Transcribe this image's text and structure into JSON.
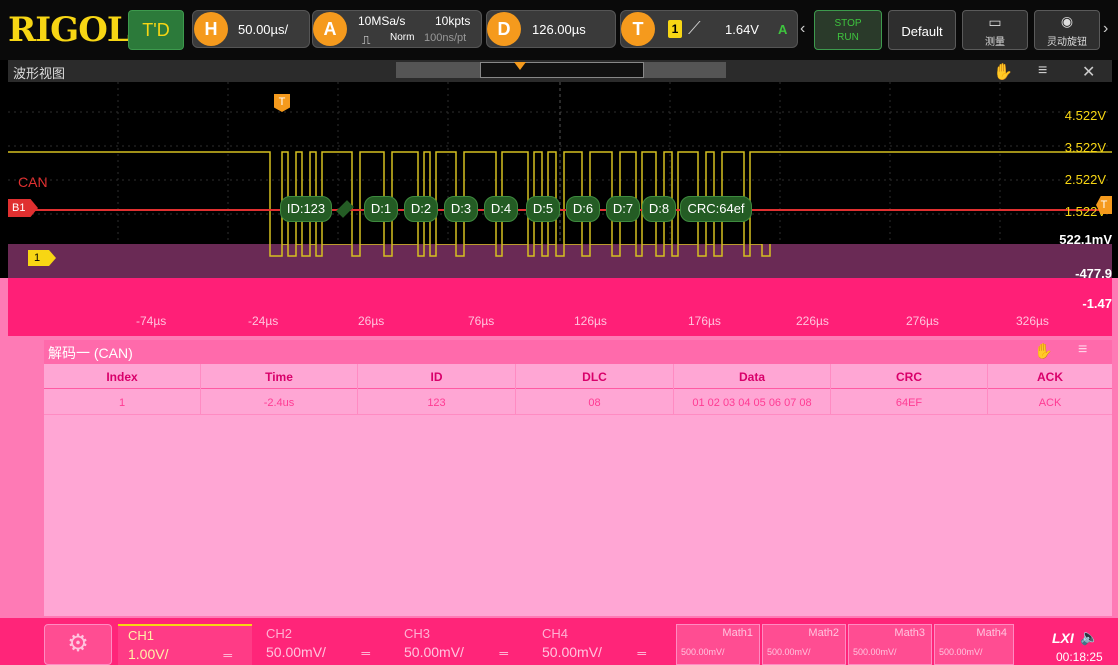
{
  "brand": "RIGOL",
  "topbar": {
    "td": "T'D",
    "h_icon": "H",
    "timebase": "50.00µs/",
    "a_icon": "A",
    "sample_rate": "10MSa/s",
    "acq_mode": "Norm",
    "mem_depth": "10kpts",
    "sample_interval": "100ns/pt",
    "d_icon": "D",
    "delay": "126.00µs",
    "t_icon": "T",
    "trig_source": "1",
    "trig_level": "1.64V",
    "trig_mode": "A",
    "stop_label": "STOP",
    "run_label": "RUN",
    "default_label": "Default",
    "measure_label": "测量",
    "knob_label": "灵动旋钮"
  },
  "wave_header": {
    "title": "波形视图"
  },
  "waveform": {
    "voltage_labels": [
      "4.522V",
      "3.522V",
      "2.522V",
      "1.522V",
      "522.1mV",
      "-477.9",
      "-1.47"
    ],
    "can_label": "CAN",
    "bus_marker": "B1",
    "ch1_marker": "1",
    "trigger_marker": "T",
    "decode_frames": [
      "ID:123",
      "D:1",
      "D:2",
      "D:3",
      "D:4",
      "D:5",
      "D:6",
      "D:7",
      "D:8",
      "CRC:64ef"
    ]
  },
  "time_axis": {
    "ticks": [
      "-74µs",
      "-24µs",
      "26µs",
      "76µs",
      "126µs",
      "176µs",
      "226µs",
      "276µs",
      "326µs"
    ]
  },
  "decode_panel": {
    "title": "解码一 (CAN)",
    "columns": [
      "Index",
      "Time",
      "ID",
      "DLC",
      "Data",
      "CRC",
      "ACK"
    ],
    "rows": [
      [
        "1",
        "-2.4us",
        "123",
        "08",
        "01 02 03 04 05 06 07 08",
        "64EF",
        "ACK"
      ]
    ]
  },
  "bottom_bar": {
    "channels": [
      {
        "label": "CH1",
        "value": "1.00V/"
      },
      {
        "label": "CH2",
        "value": "50.00mV/"
      },
      {
        "label": "CH3",
        "value": "50.00mV/"
      },
      {
        "label": "CH4",
        "value": "50.00mV/"
      }
    ],
    "maths": [
      {
        "label": "Math1",
        "value": "500.00mV/"
      },
      {
        "label": "Math2",
        "value": "500.00mV/"
      },
      {
        "label": "Math3",
        "value": "500.00mV/"
      },
      {
        "label": "Math4",
        "value": "500.00mV/"
      }
    ],
    "lxi": "LXI",
    "clock": "00:18:25"
  },
  "colors": {
    "ch1": "#f7d614",
    "bus": "#e03030",
    "accent": "#f59a1d",
    "decode_frame": "#2e6b2e"
  }
}
